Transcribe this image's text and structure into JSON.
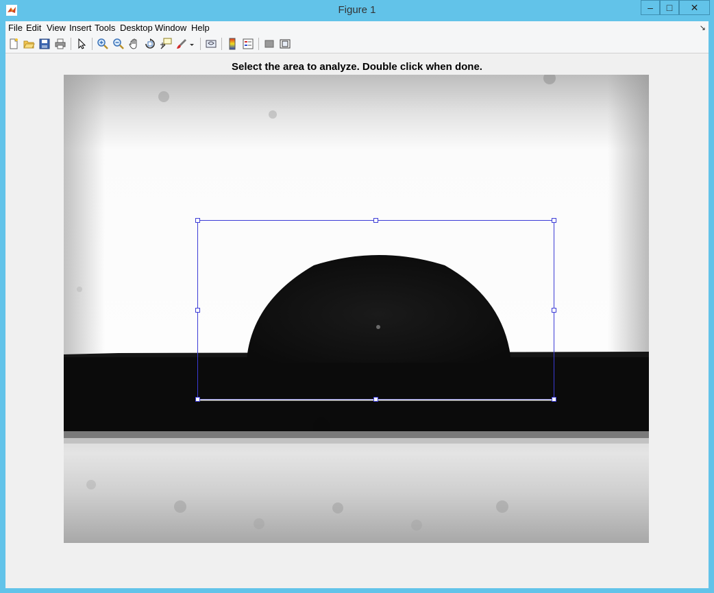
{
  "window": {
    "title": "Figure 1",
    "controls": {
      "minimize": "–",
      "maximize": "□",
      "close": "✕"
    }
  },
  "menubar": {
    "items": [
      "File",
      "Edit",
      "View",
      "Insert",
      "Tools",
      "Desktop",
      "Window",
      "Help"
    ],
    "corner": "↘"
  },
  "toolbar": {
    "buttons": [
      "new-figure-icon",
      "open-file-icon",
      "save-icon",
      "print-icon",
      "pointer-icon",
      "zoom-in-icon",
      "zoom-out-icon",
      "pan-icon",
      "rotate-3d-icon",
      "data-cursor-icon",
      "brush-icon",
      "link-plot-icon",
      "colorbar-icon",
      "legend-icon",
      "hide-plot-tools-icon",
      "show-plot-tools-icon"
    ]
  },
  "figure": {
    "instruction": "Select the area to analyze. Double click when done.",
    "image_description": "grayscale photo of sessile droplet on substrate",
    "selection_color": "#3b3bd6"
  },
  "colors": {
    "titlebar": "#62c3e9",
    "client": "#f0f0f0"
  }
}
